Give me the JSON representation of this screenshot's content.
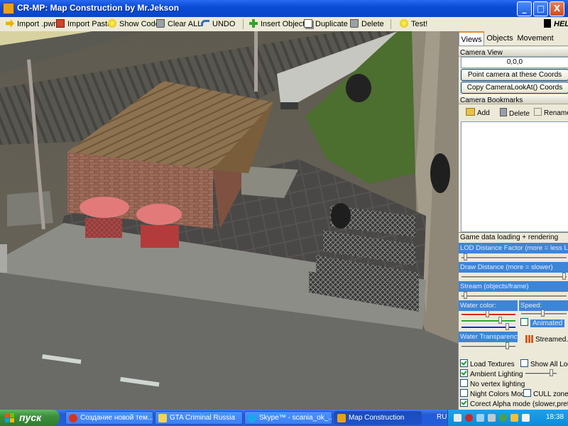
{
  "window": {
    "title": "CR-MP: Map Construction by Mr.Jekson",
    "minimize": "_",
    "maximize": "□",
    "close": "X"
  },
  "toolbar": {
    "import_pwn": "Import .pwn",
    "import_paste": "Import Paste",
    "show_code": "Show Code",
    "clear_all": "Clear ALL",
    "undo": "UNDO",
    "insert_object": "Insert Object",
    "duplicate": "Duplicate",
    "delete": "Delete",
    "test": "Test!",
    "help": "HELP"
  },
  "panel": {
    "tabs": [
      "Views",
      "Objects",
      "Movement"
    ],
    "active_tab": "Views",
    "camera_view": {
      "header": "Camera View",
      "coords": "0,0,0",
      "point_button": "Point camera at these Coords",
      "copy_button": "Copy CameraLookAt() Coords"
    },
    "bookmarks": {
      "header": "Camera Bookmarks",
      "add": "Add",
      "delete": "Delete",
      "rename": "Rename"
    },
    "options": {
      "header": "Game data loading + rendering options",
      "lod_label": "LOD Distance Factor (more = less LODs)",
      "lod_level": 0.06,
      "draw_label": "Draw Distance (more = slower)",
      "draw_level": 0.97,
      "stream_label": "Stream (objects/frame)",
      "stream_level": 0.06,
      "water_color_label": "Water color:",
      "speed_label": "Speed:",
      "animated_label": "Animated",
      "animated_checked": false,
      "transparency_label": "Water Transparency:",
      "streamed_label": "Streamed..",
      "load_textures": "Load Textures",
      "load_textures_checked": true,
      "show_all_lods": "Show All Lods",
      "show_all_lods_checked": false,
      "ambient_lighting": "Ambient Lighting",
      "ambient_lighting_checked": true,
      "no_vertex_lighting": "No vertex lighting",
      "no_vertex_lighting_checked": false,
      "night_colors": "Night Colors Mode",
      "night_colors_checked": false,
      "cull_zones": "CULL zones",
      "cull_zones_checked": false,
      "alpha_mode": "Corect Alpha mode (slower,prettier)",
      "alpha_mode_checked": true
    }
  },
  "taskbar": {
    "start": "пуск",
    "tasks": [
      {
        "label": "Создание новой тем...",
        "color": "#d8341c"
      },
      {
        "label": "GTA Criminal Russia",
        "color": "#f4d35a"
      },
      {
        "label": "Skype™ - scania_ok_...",
        "color": "#19a8e8"
      },
      {
        "label": "Map Construction",
        "color": "#e8a21a"
      }
    ],
    "lang": "RU",
    "clock": "18:38"
  },
  "colors": {
    "accent": "#0b4cd6",
    "option_label_bg": "#3d85d8"
  }
}
